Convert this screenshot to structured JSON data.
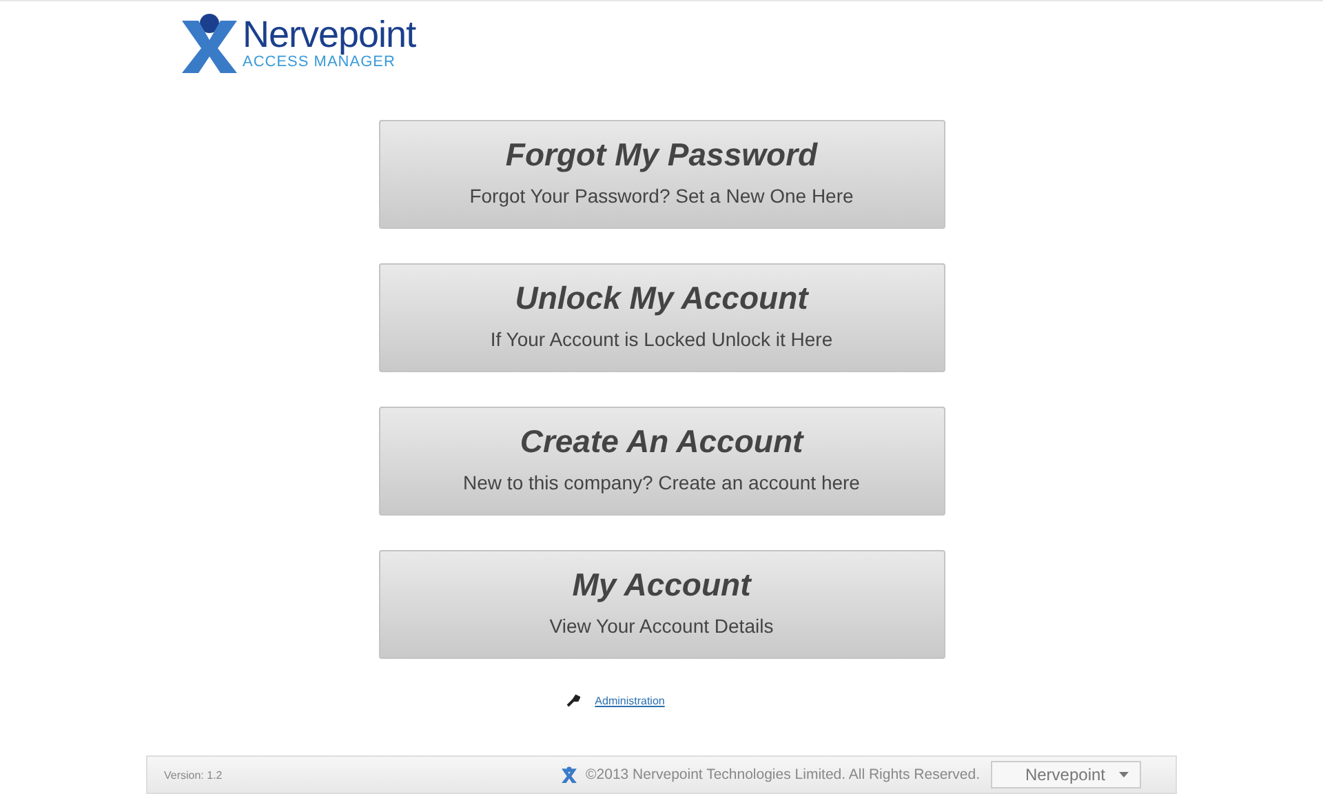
{
  "logo": {
    "name": "Nervepoint",
    "tagline": "ACCESS MANAGER"
  },
  "actions": [
    {
      "title": "Forgot My Password",
      "subtitle": "Forgot Your Password? Set a New One Here"
    },
    {
      "title": "Unlock My Account",
      "subtitle": "If Your Account is Locked Unlock it Here"
    },
    {
      "title": "Create An Account",
      "subtitle": "New to this company? Create an account here"
    },
    {
      "title": "My Account",
      "subtitle": "View Your Account Details"
    }
  ],
  "admin_link": "Administration",
  "footer": {
    "version": "Version: 1.2",
    "copyright": "©2013 Nervepoint Technologies Limited. All Rights Reserved.",
    "dropdown": "Nervepoint"
  }
}
